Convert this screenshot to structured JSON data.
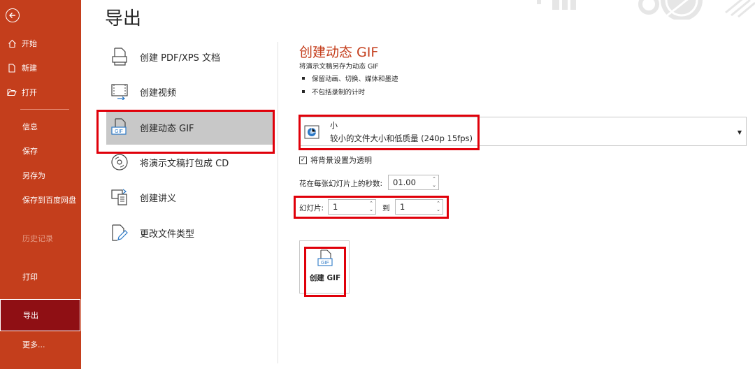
{
  "sidebar": {
    "items": [
      {
        "label": "开始"
      },
      {
        "label": "新建"
      },
      {
        "label": "打开"
      },
      {
        "label": "信息"
      },
      {
        "label": "保存"
      },
      {
        "label": "另存为"
      },
      {
        "label": "保存到百度网盘"
      },
      {
        "label": "历史记录"
      },
      {
        "label": "打印"
      },
      {
        "label": "导出"
      },
      {
        "label": "更多..."
      }
    ],
    "accent": "#c43e1c",
    "active_bg": "#8f0f14"
  },
  "page_title": "导出",
  "export_options": [
    {
      "label": "创建 PDF/XPS 文档",
      "icon": "pdf-document-icon"
    },
    {
      "label": "创建视频",
      "icon": "video-icon"
    },
    {
      "label": "创建动态 GIF",
      "icon": "gif-icon"
    },
    {
      "label": "将演示文稿打包成 CD",
      "icon": "cd-icon"
    },
    {
      "label": "创建讲义",
      "icon": "handout-icon"
    },
    {
      "label": "更改文件类型",
      "icon": "change-file-type-icon"
    }
  ],
  "gif_panel": {
    "title": "创建动态 GIF",
    "description": "将演示文稿另存为动态 GIF",
    "bullets": [
      "保留动画、切换、媒体和墨迹",
      "不包括录制的计时"
    ],
    "quality": {
      "name": "小",
      "detail": "较小的文件大小和低质量 (240p 15fps)"
    },
    "transparent_label": "将背景设置为透明",
    "seconds_label": "花在每张幻灯片上的秒数:",
    "seconds_value": "01.00",
    "slides_label": "幻灯片:",
    "slides_from": "1",
    "to_label": "到",
    "slides_to": "1",
    "create_button": "创建 GIF"
  },
  "colors": {
    "title": "#c43e1c",
    "highlight": "#e0000a"
  }
}
